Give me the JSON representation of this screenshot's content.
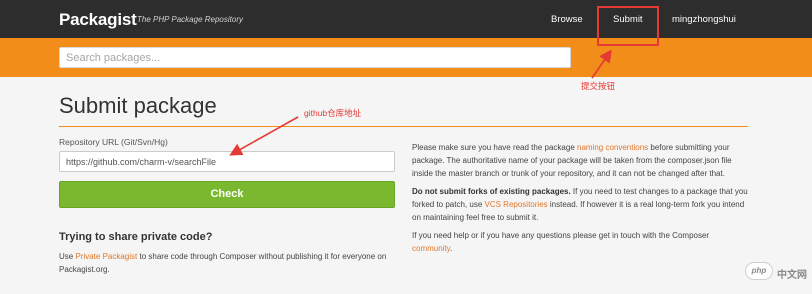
{
  "header": {
    "brand": "Packagist",
    "tagline": "The PHP Package Repository",
    "nav": {
      "browse": "Browse",
      "submit": "Submit",
      "user": "mingzhongshui"
    }
  },
  "search": {
    "placeholder": "Search packages..."
  },
  "main": {
    "title": "Submit package",
    "repo_label": "Repository URL (Git/Svn/Hg)",
    "repo_value": "https://github.com/charm-v/searchFile",
    "check_label": "Check",
    "private_heading": "Trying to share private code?",
    "private_text": {
      "before": "Use ",
      "link": "Private Packagist",
      "after": " to share code through Composer without publishing it for everyone on Packagist.org."
    }
  },
  "info": {
    "p1": {
      "before": "Please make sure you have read the package ",
      "link": "naming conventions",
      "after": " before submitting your package. The authoritative name of your package will be taken from the composer.json file inside the master branch or trunk of your repository, and it can not be changed after that."
    },
    "p2": {
      "bold": "Do not submit forks of existing packages.",
      "before": " If you need to test changes to a package that you forked to patch, use ",
      "link": "VCS Repositories",
      "after": " instead. If however it is a real long-term fork you intend on maintaining feel free to submit it."
    },
    "p3": {
      "before": "If you need help or if you have any questions please get in touch with the Composer ",
      "link": "community",
      "after": "."
    }
  },
  "annotations": {
    "submit_note": "提交按钮",
    "github_note": "github仓库地址"
  },
  "watermark": {
    "logo": "php",
    "text": "中文网"
  },
  "colors": {
    "navbar": "#2d2d2d",
    "accent_orange": "#f28d1a",
    "button_green": "#7ab92f",
    "link_orange": "#e0782c",
    "annotation_red": "#e53935"
  }
}
